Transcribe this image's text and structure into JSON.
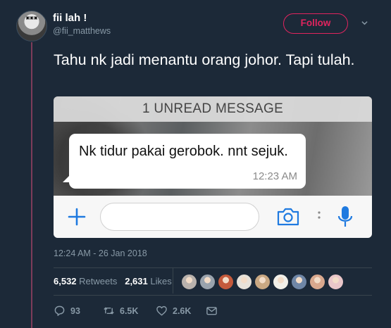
{
  "tweet": {
    "display_name": "fii lah !",
    "handle": "@fii_matthews",
    "follow_label": "Follow",
    "text": "Tahu nk jadi menantu orang johor. Tapi tulah.",
    "timestamp": "12:24 AM - 26 Jan 2018",
    "retweets_count": "6,532",
    "retweets_label": "Retweets",
    "likes_count": "2,631",
    "likes_label": "Likes",
    "reply_count": "93",
    "retweet_action_count": "6.5K",
    "like_action_count": "2.6K",
    "accent_color": "#e0245e"
  },
  "media": {
    "unread_banner": "1 UNREAD MESSAGE",
    "message_text": "Nk tidur pakai gerobok. nnt sejuk.",
    "message_time": "12:23 AM"
  },
  "likers": [
    {
      "name": "liker-avatar-1",
      "color": "#b9b2ad"
    },
    {
      "name": "liker-avatar-2",
      "color": "#9aa3ad"
    },
    {
      "name": "liker-avatar-3",
      "color": "#c45a3c"
    },
    {
      "name": "liker-avatar-4",
      "color": "#e7e2da"
    },
    {
      "name": "liker-avatar-5",
      "color": "#c9a883"
    },
    {
      "name": "liker-avatar-6",
      "color": "#f1efe8"
    },
    {
      "name": "liker-avatar-7",
      "color": "#6f86a6"
    },
    {
      "name": "liker-avatar-8",
      "color": "#d9a88e"
    },
    {
      "name": "liker-avatar-9",
      "color": "#e9c6c9"
    }
  ]
}
